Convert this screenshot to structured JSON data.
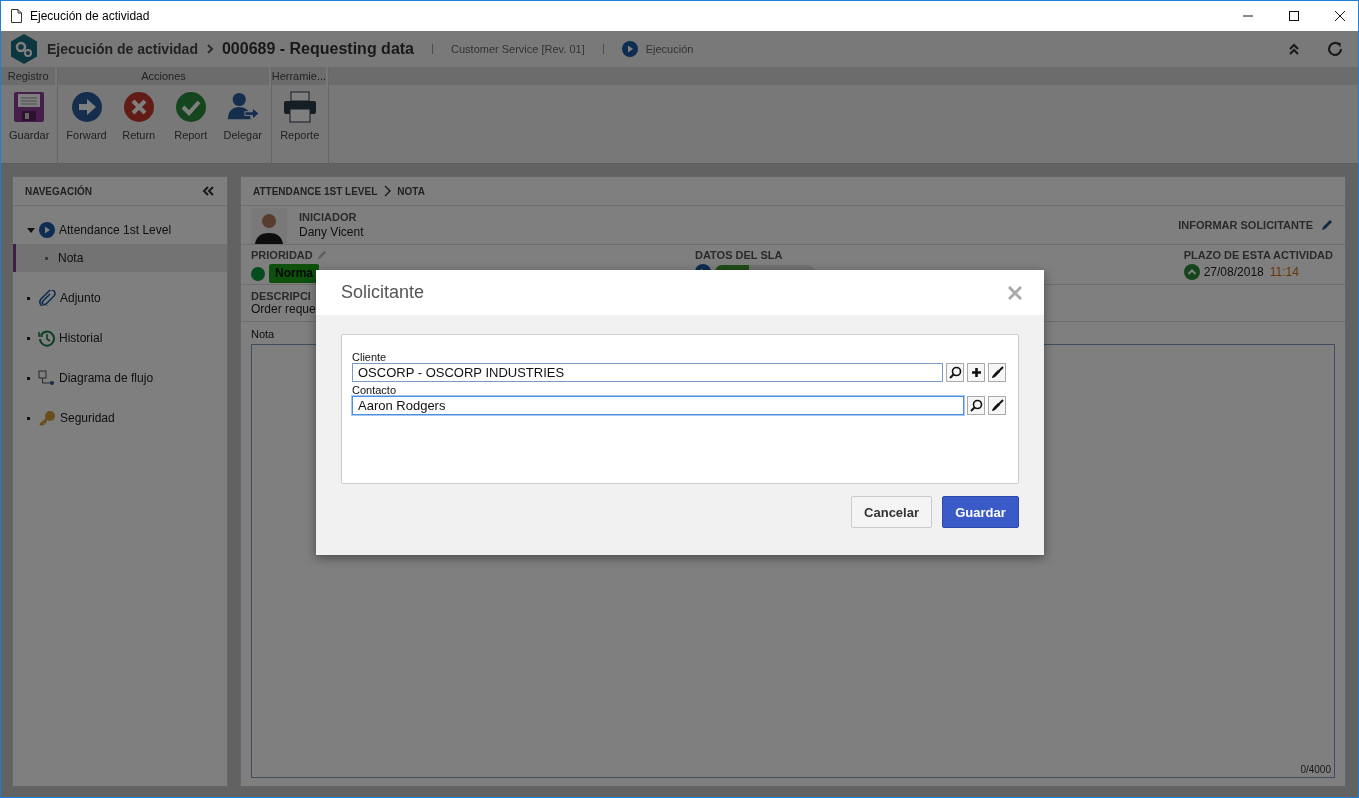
{
  "window": {
    "title": "Ejecución de actividad"
  },
  "header": {
    "app_title": "Ejecución de actividad",
    "record_title": "000689 - Requesting data",
    "process": "Customer Service [Rev. 01]",
    "status": "Ejecución"
  },
  "toolbar": [
    {
      "label": "Registro",
      "buttons": [
        {
          "label": "Guardar",
          "kind": "save"
        }
      ]
    },
    {
      "label": "Acciones",
      "buttons": [
        {
          "label": "Forward",
          "kind": "forward"
        },
        {
          "label": "Return",
          "kind": "return"
        },
        {
          "label": "Report",
          "kind": "report"
        },
        {
          "label": "Delegar",
          "kind": "delegate"
        }
      ]
    },
    {
      "label": "Herramie...",
      "buttons": [
        {
          "label": "Reporte",
          "kind": "print"
        }
      ]
    }
  ],
  "navigation": {
    "title": "NAVEGACIÓN",
    "items": [
      {
        "label": "Attendance 1st Level",
        "kind": "play",
        "expanded": true,
        "selected": false,
        "children": [
          {
            "label": "Nota",
            "selected": true
          }
        ]
      },
      {
        "label": "Adjunto",
        "kind": "clip",
        "selected": false
      },
      {
        "label": "Historial",
        "kind": "history",
        "selected": false
      },
      {
        "label": "Diagrama de flujo",
        "kind": "flow",
        "selected": false
      },
      {
        "label": "Seguridad",
        "kind": "key",
        "selected": false
      }
    ]
  },
  "content": {
    "breadcrumb": [
      "ATTENDANCE 1ST LEVEL",
      "NOTA"
    ],
    "initiator": {
      "label": "INICIADOR",
      "name": "Dany Vicent"
    },
    "inform_link": "INFORMAR SOLICITANTE",
    "priority": {
      "label": "PRIORIDAD",
      "value": "Norma"
    },
    "sla": {
      "label": "DATOS DEL SLA",
      "level": 0.34
    },
    "deadline": {
      "label": "PLAZO DE ESTA ACTIVIDAD",
      "date": "27/08/2018",
      "time": "11:14"
    },
    "description": {
      "label": "DESCRIPCI",
      "text": "Order reque"
    },
    "note": {
      "label": "Nota",
      "counter": "0/4000"
    }
  },
  "dialog": {
    "title": "Solicitante",
    "fields": [
      {
        "label": "Cliente",
        "value": "OSCORP - OSCORP INDUSTRIES",
        "focused": false,
        "actions": [
          {
            "kind": "search"
          },
          {
            "kind": "add"
          },
          {
            "kind": "clear"
          }
        ]
      },
      {
        "label": "Contacto",
        "value": "Aaron Rodgers",
        "focused": true,
        "actions": [
          {
            "kind": "search"
          },
          {
            "kind": "clear"
          }
        ]
      }
    ],
    "buttons": [
      {
        "label": "Cancelar",
        "kind": "secondary"
      },
      {
        "label": "Guardar",
        "kind": "primary"
      }
    ]
  }
}
